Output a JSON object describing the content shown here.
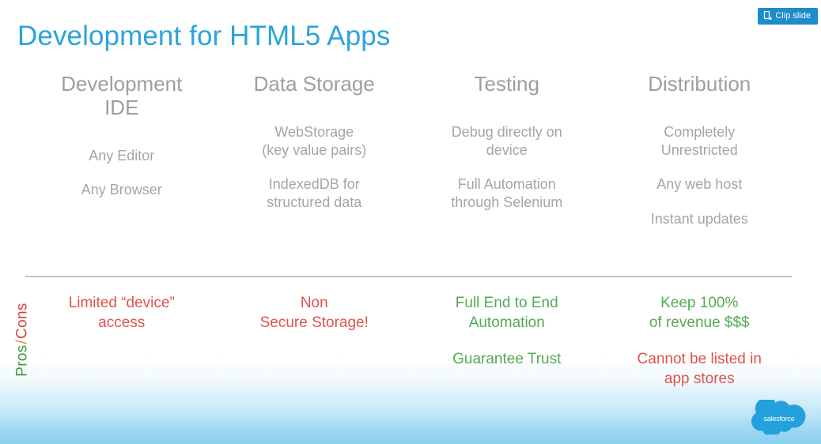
{
  "slide": {
    "title": "Development for HTML5 Apps",
    "title_color": "#2ba4da",
    "background": "#ffffff"
  },
  "clip_button": {
    "label": "Clip slide",
    "icon": "clip-icon",
    "background": "#1e8ccb",
    "text_color": "#ffffff"
  },
  "columns": [
    {
      "header": "Development\nIDE",
      "items": [
        "Any Editor",
        "Any Browser"
      ]
    },
    {
      "header": "Data Storage",
      "items": [
        "WebStorage\n(key value pairs)",
        "IndexedDB for\nstructured data"
      ]
    },
    {
      "header": "Testing",
      "items": [
        "Debug directly on\ndevice",
        "Full Automation\nthrough Selenium"
      ]
    },
    {
      "header": "Distribution",
      "items": [
        "Completely\nUnrestricted",
        "Any web host",
        "Instant updates"
      ]
    }
  ],
  "proscons_label": {
    "pros": "Pros",
    "separator": "/",
    "cons": "Cons",
    "pros_color": "#3f9b3f",
    "cons_color": "#d8433f"
  },
  "bottom_row": [
    {
      "entries": [
        {
          "text": "Limited “device”\naccess",
          "tone": "con"
        }
      ]
    },
    {
      "entries": [
        {
          "text": "Non\nSecure Storage!",
          "tone": "con"
        }
      ]
    },
    {
      "entries": [
        {
          "text": "Full End to End\nAutomation",
          "tone": "pro"
        },
        {
          "text": "Guarantee Trust",
          "tone": "pro"
        }
      ]
    },
    {
      "entries": [
        {
          "text": "Keep 100%\nof revenue $$$",
          "tone": "pro"
        },
        {
          "text": "Cannot be listed in\napp stores",
          "tone": "con"
        }
      ]
    }
  ],
  "brand": {
    "name": "salesforce",
    "logo_color": "#22a1dd"
  },
  "colors": {
    "heading_grey": "#9b9fa3",
    "body_grey": "#a2a6aa",
    "pro_green": "#52ab52",
    "con_red": "#e0514d",
    "divider": "#bfc3c7",
    "bottom_wash": "#8acfee"
  }
}
